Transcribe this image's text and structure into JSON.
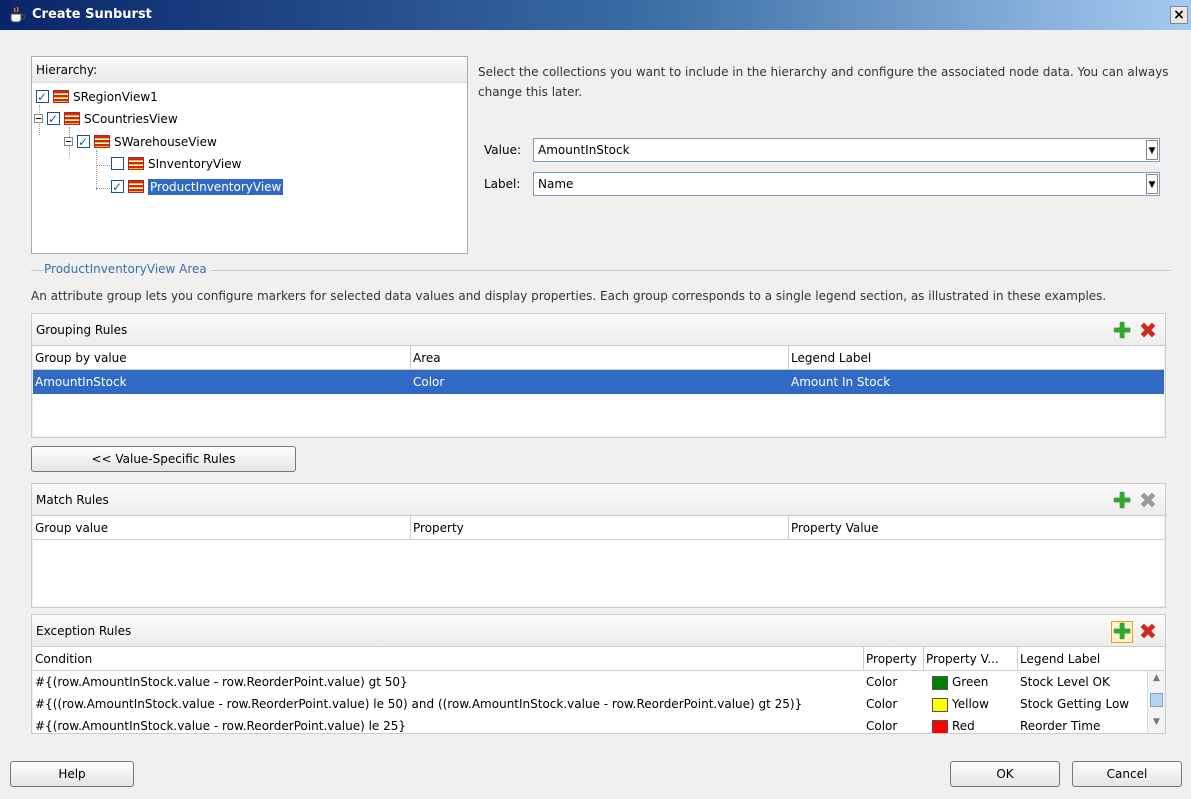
{
  "window": {
    "title": "Create Sunburst",
    "close": "×"
  },
  "hierarchy": {
    "title": "Hierarchy:",
    "nodes": [
      "SRegionView1",
      "SCountriesView",
      "SWarehouseView",
      "SInventoryView",
      "ProductInventoryView"
    ]
  },
  "intro": "Select the collections you want to include in the hierarchy and configure the associated node data. You can always change this later.",
  "value_field": {
    "label": "Value:",
    "value": "AmountInStock"
  },
  "label_field": {
    "label": "Label:",
    "value": "Name"
  },
  "area_section": {
    "title": "ProductInventoryView Area",
    "description": "An attribute group lets you configure markers for selected data values and display properties. Each group corresponds to a single legend section, as illustrated in these examples."
  },
  "grouping": {
    "title": "Grouping Rules",
    "columns": [
      "Group by value",
      "Area",
      "Legend Label"
    ],
    "rows": [
      [
        "AmountInStock",
        "Color",
        "Amount In Stock"
      ]
    ]
  },
  "value_specific_button": "<< Value-Specific Rules",
  "match": {
    "title": "Match Rules",
    "columns": [
      "Group value",
      "Property",
      "Property Value"
    ]
  },
  "exception": {
    "title": "Exception Rules",
    "columns": [
      "Condition",
      "Property",
      "Property V...",
      "Legend Label"
    ],
    "rows": [
      {
        "condition": "#{(row.AmountInStock.value - row.ReorderPoint.value) gt 50}",
        "property": "Color",
        "value": "Green",
        "color": "#008000",
        "legend": "Stock Level OK"
      },
      {
        "condition": "#{((row.AmountInStock.value - row.ReorderPoint.value) le 50) and ((row.AmountInStock.value - row.ReorderPoint.value) gt 25)}",
        "property": "Color",
        "value": "Yellow",
        "color": "#ffff00",
        "legend": "Stock Getting Low"
      },
      {
        "condition": "#{(row.AmountInStock.value - row.ReorderPoint.value) le 25}",
        "property": "Color",
        "value": "Red",
        "color": "#ff0000",
        "legend": "Reorder Time"
      }
    ]
  },
  "buttons": {
    "help": "Help",
    "ok": "OK",
    "cancel": "Cancel"
  }
}
